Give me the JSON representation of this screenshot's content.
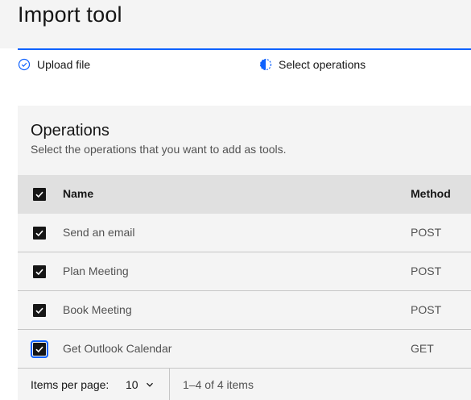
{
  "page": {
    "title": "Import tool"
  },
  "steps": [
    {
      "label": "Upload file",
      "state": "complete",
      "icon": "check-circle-icon"
    },
    {
      "label": "Select operations",
      "state": "current",
      "icon": "half-circle-icon"
    }
  ],
  "progress": {
    "fraction": 1.0
  },
  "colors": {
    "accent": "#0f62fe",
    "panel_bg": "#f4f4f4",
    "header_row_bg": "#e0e0e0",
    "checkbox": "#161616"
  },
  "operations": {
    "title": "Operations",
    "subtitle": "Select the operations that you want to add as tools.",
    "columns": {
      "name": "Name",
      "method": "Method"
    },
    "rows": [
      {
        "name": "Send an email",
        "method": "POST",
        "checked": true
      },
      {
        "name": "Plan Meeting",
        "method": "POST",
        "checked": true
      },
      {
        "name": "Book Meeting",
        "method": "POST",
        "checked": true
      },
      {
        "name": "Get Outlook Calendar",
        "method": "GET",
        "checked": true,
        "focused": true
      }
    ]
  },
  "pagination": {
    "items_per_page_label": "Items per page:",
    "items_per_page_value": "10",
    "range_text": "1–4 of 4 items"
  }
}
